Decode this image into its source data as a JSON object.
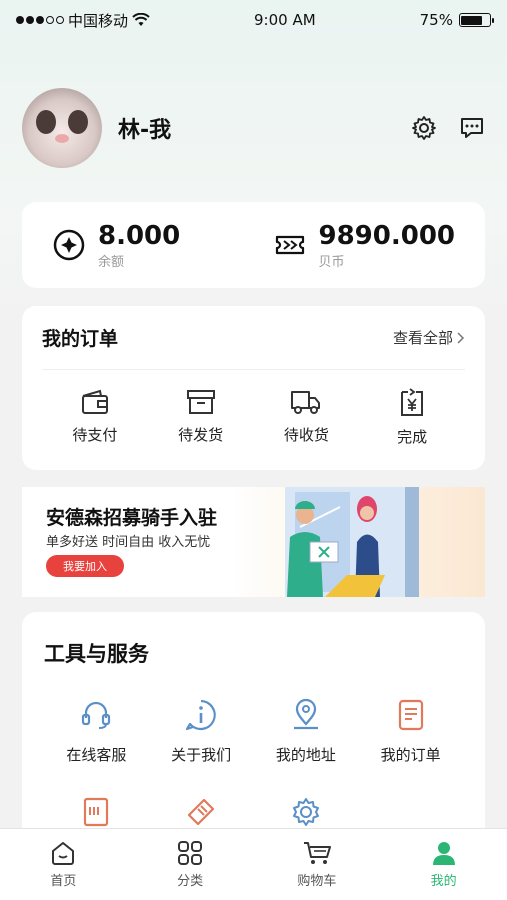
{
  "status_bar": {
    "carrier": "中国移动",
    "time": "9:00 AM",
    "battery": "75%",
    "battery_level": 0.75
  },
  "profile": {
    "username": "林-我"
  },
  "wallet": {
    "balance_value": "8.000",
    "balance_label": "余额",
    "coins_value": "9890.000",
    "coins_label": "贝币"
  },
  "orders": {
    "title": "我的订单",
    "view_all": "查看全部",
    "items": [
      {
        "label": "待支付",
        "icon": "wallet-icon"
      },
      {
        "label": "待发货",
        "icon": "box-icon"
      },
      {
        "label": "待收货",
        "icon": "truck-icon"
      },
      {
        "label": "完成",
        "icon": "yen-doc-icon"
      }
    ]
  },
  "banner": {
    "title": "安德森招募骑手入驻",
    "subtitle": "单多好送 时间自由 收入无忧",
    "button": "我要加入"
  },
  "tools": {
    "title": "工具与服务",
    "items": [
      {
        "label": "在线客服",
        "icon": "headset-icon"
      },
      {
        "label": "关于我们",
        "icon": "info-icon"
      },
      {
        "label": "我的地址",
        "icon": "location-icon"
      },
      {
        "label": "我的订单",
        "icon": "order-doc-icon"
      }
    ]
  },
  "tab_bar": {
    "items": [
      {
        "label": "首页",
        "icon": "home-icon"
      },
      {
        "label": "分类",
        "icon": "grid-icon"
      },
      {
        "label": "购物车",
        "icon": "cart-icon"
      },
      {
        "label": "我的",
        "icon": "user-icon",
        "active": true
      }
    ]
  },
  "colors": {
    "accent": "#2bb673",
    "banner_button": "#e8423f"
  }
}
